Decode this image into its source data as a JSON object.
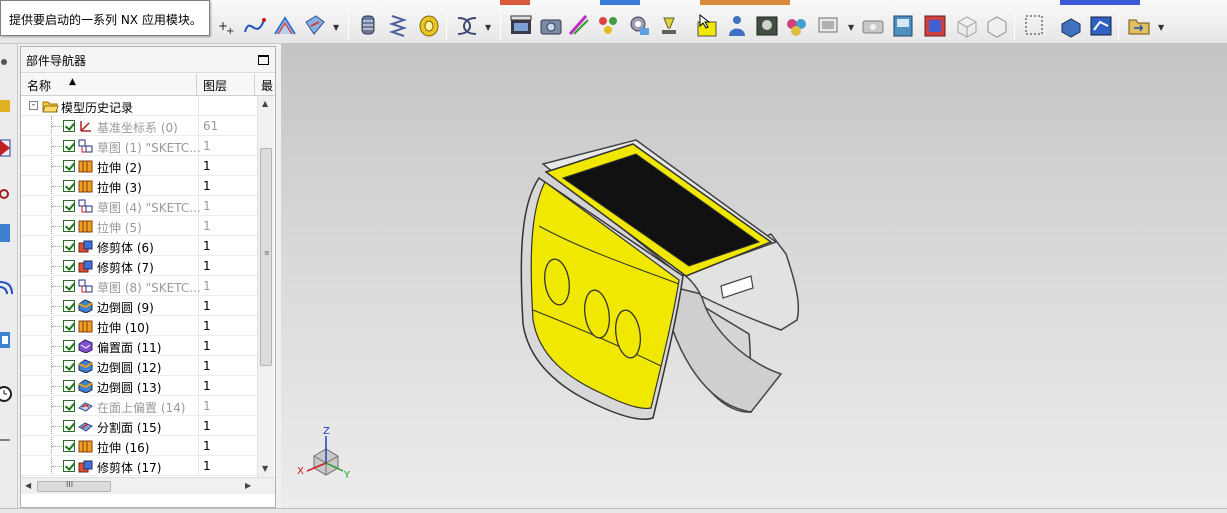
{
  "tooltip": {
    "text": "提供要启动的一系列 NX 应用模块。"
  },
  "toolbar": {
    "buttons": [
      "point-icon",
      "spline-icon",
      "offset-curve-icon",
      "sweep-icon",
      "project-icon",
      "cylinder-icon",
      "spring-icon",
      "coin-icon",
      "helix-icon",
      "clapper-icon",
      "camera-icon",
      "palette-icon",
      "spheres-icon",
      "gear-icon",
      "lamp-icon",
      "cursor-select-icon",
      "person-icon",
      "photo-icon",
      "material-icon",
      "monitor-icon",
      "camera-grey-icon",
      "cube-blue-icon",
      "colormap-icon",
      "wireframe-icon",
      "cube-outline-icon",
      "frame-icon",
      "box-blue-icon",
      "analysis-icon",
      "folder-move-icon"
    ]
  },
  "navigator": {
    "title": "部件导航器",
    "columns": {
      "name": "名称",
      "layer": "图层",
      "extra": "最"
    },
    "root": {
      "label": "模型历史记录"
    },
    "items": [
      {
        "label": "基准坐标系 (0)",
        "layer": "61",
        "icon": "datum-csys-icon",
        "dim": true
      },
      {
        "label": "草图 (1) \"SKETC...",
        "layer": "1",
        "icon": "sketch-icon",
        "dim": true
      },
      {
        "label": "拉伸 (2)",
        "layer": "1",
        "icon": "extrude-icon",
        "dim": false
      },
      {
        "label": "拉伸 (3)",
        "layer": "1",
        "icon": "extrude-icon",
        "dim": false
      },
      {
        "label": "草图 (4) \"SKETC...",
        "layer": "1",
        "icon": "sketch-icon",
        "dim": true
      },
      {
        "label": "拉伸 (5)",
        "layer": "1",
        "icon": "extrude-icon",
        "dim": true
      },
      {
        "label": "修剪体 (6)",
        "layer": "1",
        "icon": "trim-body-icon",
        "dim": false
      },
      {
        "label": "修剪体 (7)",
        "layer": "1",
        "icon": "trim-body-icon",
        "dim": false
      },
      {
        "label": "草图 (8) \"SKETC...",
        "layer": "1",
        "icon": "sketch-icon",
        "dim": true
      },
      {
        "label": "边倒圆 (9)",
        "layer": "1",
        "icon": "edge-blend-icon",
        "dim": false
      },
      {
        "label": "拉伸 (10)",
        "layer": "1",
        "icon": "extrude-icon",
        "dim": false
      },
      {
        "label": "偏置面 (11)",
        "layer": "1",
        "icon": "offset-face-icon",
        "dim": false
      },
      {
        "label": "边倒圆 (12)",
        "layer": "1",
        "icon": "edge-blend-icon",
        "dim": false
      },
      {
        "label": "边倒圆 (13)",
        "layer": "1",
        "icon": "edge-blend-icon",
        "dim": false
      },
      {
        "label": "在面上偏置 (14)",
        "layer": "1",
        "icon": "offset-on-face-icon",
        "dim": true
      },
      {
        "label": "分割面 (15)",
        "layer": "1",
        "icon": "divide-face-icon",
        "dim": false
      },
      {
        "label": "拉伸 (16)",
        "layer": "1",
        "icon": "extrude-icon",
        "dim": false
      },
      {
        "label": "修剪体 (17)",
        "layer": "1",
        "icon": "trim-body-icon",
        "dim": false
      }
    ],
    "hscroll_label": "III"
  },
  "viewport": {
    "triad": {
      "x_label": "X",
      "y_label": "Y",
      "z_label": "Z"
    },
    "model": {
      "primary_color": "#f0e800",
      "top_color": "#111111",
      "body_color": "#dcdcdc"
    }
  },
  "colors": {
    "accent_yellow": "#f0e800",
    "check_green": "#1a7a1a"
  }
}
